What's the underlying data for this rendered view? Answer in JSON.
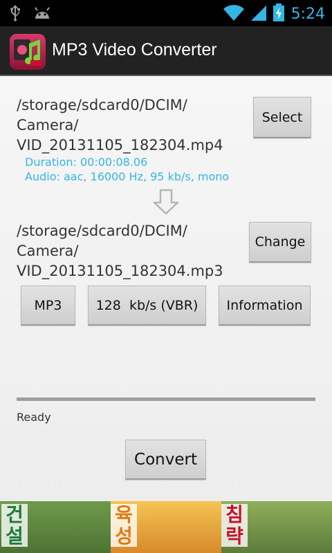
{
  "status_bar": {
    "time": "5:24",
    "icons": [
      "usb-icon",
      "android-icon",
      "wifi-icon",
      "signal-icon",
      "battery-charging-icon"
    ]
  },
  "app": {
    "title": "MP3 Video Converter",
    "icon": "app-logo-icon"
  },
  "source": {
    "path_lines": [
      "/storage/sdcard0/DCIM/",
      "Camera/",
      "VID_20131105_182304.mp4"
    ],
    "duration": "Duration: 00:00:08.06",
    "audio": "Audio: aac, 16000 Hz, 95 kb/s, mono",
    "select_label": "Select"
  },
  "arrow_icon": "down-arrow-icon",
  "output": {
    "path_lines": [
      "/storage/sdcard0/DCIM/",
      "Camera/",
      "VID_20131105_182304.mp3"
    ],
    "change_label": "Change"
  },
  "options": {
    "format_label": "MP3",
    "bitrate_label": "128  kb/s (VBR)",
    "information_label": "Information"
  },
  "progress": {
    "value": 0
  },
  "status_text": "Ready",
  "convert_label": "Convert",
  "ad": {
    "words": [
      "건설",
      "육성",
      "침략"
    ],
    "colors": [
      "#1e7a3a",
      "#e07a10",
      "#c8102e"
    ]
  },
  "colors": {
    "accent": "#33b5e5",
    "actionbar": "#222222"
  }
}
